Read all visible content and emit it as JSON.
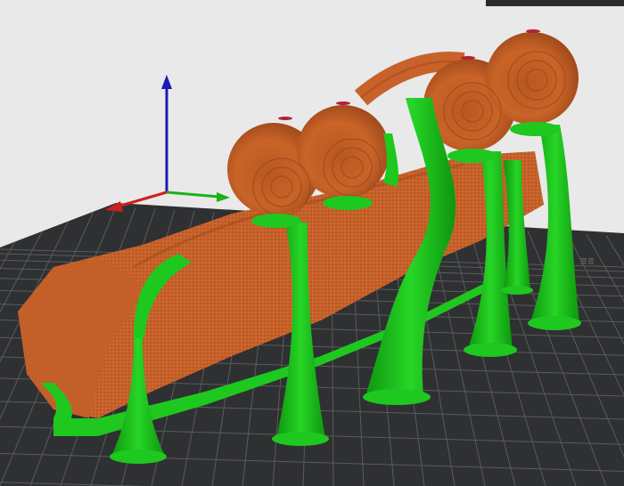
{
  "viewport": {
    "background": "#e9e9e9",
    "bed_color": "#2f3032",
    "bed_grid_color": "#5a5b5d",
    "model_color": "#c8612a",
    "model_dark": "#a24b1d",
    "support_color": "#19c419",
    "support_dark": "#0f8f0f",
    "interface_color": "#b3203a",
    "axis": {
      "x_color": "#cc1f1f",
      "y_color": "#19b219",
      "z_color": "#1a1ab5"
    },
    "bed_logo_text": "≡≡",
    "top_toolbar": "toolbar"
  }
}
